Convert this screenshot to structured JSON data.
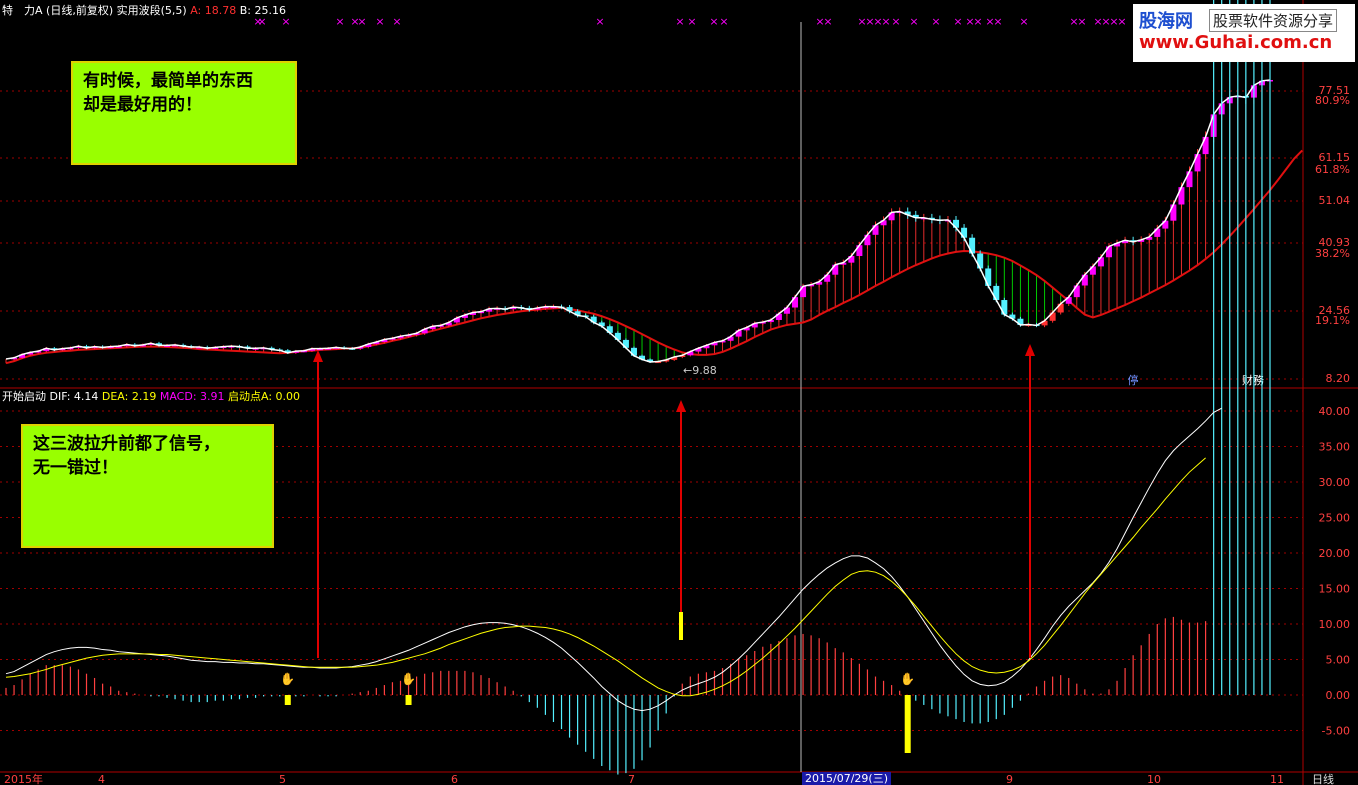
{
  "colors": {
    "up": "#ff3030",
    "down": "#54f0ff",
    "magenta": "#ff00ff",
    "white": "#ffffff",
    "yellow": "#ffff00",
    "grid": "#a00000",
    "axis": "#b00000",
    "green": "#00e000"
  },
  "header": {
    "stock": "特　力A",
    "mode": "(日线,前复权)",
    "indicator": "实用波段(5,5)",
    "a_label": "A: 18.78",
    "b_label": "B: 25.16"
  },
  "subheader": {
    "name": "开始启动",
    "dif": "DIF: 4.14",
    "dea": "DEA: 2.19",
    "macd": "MACD: 3.91",
    "start": "启动点A: 0.00"
  },
  "brand": {
    "name": "股海网",
    "slogan": "股票软件资源分享",
    "url": "www.Guhai.com.cn"
  },
  "notes": {
    "top": "有时候，最简单的东西\n却是最好用的！",
    "bottom": "这三波拉升前都了信号，\n无一错过！"
  },
  "chart_data": [
    {
      "type": "line",
      "title": "实用波段(5,5)",
      "y_ticks": [
        "77.51",
        "61.15",
        "51.04",
        "40.93",
        "24.56",
        "8.20"
      ],
      "pct_ticks": [
        "80.9%",
        "61.8%",
        "38.2%",
        "19.1%"
      ],
      "annotations": {
        "low_label": "←9.88",
        "stop_tag": "停",
        "fin_tag": "财務"
      },
      "series": [
        {
          "name": "price",
          "values": [
            13.0,
            13.3,
            14.1,
            14.6,
            14.9,
            15.6,
            15.2,
            15.5,
            15.7,
            16.1,
            15.7,
            16.0,
            15.8,
            16.0,
            16.1,
            16.5,
            16.2,
            16.4,
            16.8,
            16.3,
            16.3,
            16.4,
            16.1,
            15.9,
            15.9,
            15.6,
            15.8,
            16.0,
            16.1,
            16.0,
            15.6,
            15.6,
            15.7,
            15.3,
            15.1,
            14.5,
            14.9,
            15.0,
            15.5,
            15.5,
            15.6,
            15.8,
            15.6,
            15.5,
            15.9,
            16.6,
            17.1,
            17.7,
            18.0,
            18.5,
            18.8,
            19.2,
            20.2,
            20.9,
            21.1,
            21.8,
            22.9,
            23.6,
            24.2,
            24.4,
            25.1,
            25.2,
            25.0,
            25.5,
            25.3,
            24.9,
            25.3,
            25.6,
            25.6,
            25.5,
            24.5,
            23.5,
            23.2,
            21.8,
            20.9,
            19.3,
            17.6,
            15.7,
            13.8,
            12.9,
            12.3,
            12.4,
            12.8,
            13.5,
            13.9,
            14.8,
            15.6,
            16.3,
            17.0,
            17.4,
            18.4,
            19.9,
            20.6,
            21.6,
            21.9,
            22.4,
            23.9,
            25.4,
            27.9,
            30.5,
            30.9,
            31.6,
            33.3,
            35.7,
            36.2,
            37.8,
            40.4,
            42.9,
            45.2,
            46.4,
            48.3,
            48.5,
            47.7,
            47.0,
            47.0,
            46.6,
            46.4,
            46.5,
            44.6,
            42.2,
            38.4,
            34.8,
            30.6,
            27.2,
            23.7,
            22.7,
            21.2,
            21.3,
            21.1,
            22.2,
            24.2,
            26.3,
            27.9,
            30.7,
            33.3,
            35.3,
            37.5,
            40.1,
            40.9,
            41.6,
            41.2,
            41.7,
            42.4,
            44.4,
            46.3,
            50.2,
            54.3,
            58.0,
            62.1,
            66.3,
            71.8,
            74.5,
            76.0,
            76.3,
            75.9,
            78.9,
            80.0,
            80.2
          ]
        },
        {
          "name": "support",
          "values": [
            12.0,
            12.5,
            13.2,
            13.8,
            14.2,
            14.5,
            14.7,
            14.9,
            15.0,
            15.2,
            15.3,
            15.4,
            15.5,
            15.6,
            15.7,
            15.8,
            15.9,
            16.0,
            16.0,
            16.0,
            15.9,
            15.8,
            15.7,
            15.6,
            15.4,
            15.3,
            15.2,
            15.1,
            15.0,
            14.9,
            14.8,
            14.7,
            14.6,
            14.5,
            14.4,
            14.5,
            14.7,
            14.9,
            15.0,
            15.2,
            15.3,
            15.4,
            15.5,
            15.6,
            15.7,
            16.1,
            16.5,
            16.9,
            17.4,
            17.8,
            18.3,
            18.8,
            19.3,
            19.8,
            20.3,
            20.8,
            21.3,
            21.8,
            22.3,
            22.8,
            23.2,
            23.6,
            23.9,
            24.2,
            24.5,
            24.7,
            24.9,
            25.1,
            25.2,
            25.3,
            25.0,
            24.7,
            24.3,
            23.9,
            23.3,
            22.6,
            21.8,
            20.9,
            20.0,
            19.0,
            18.0,
            17.0,
            16.1,
            15.3,
            14.6,
            14.2,
            14.0,
            14.0,
            14.2,
            14.7,
            15.5,
            16.4,
            17.3,
            18.3,
            19.2,
            20.1,
            20.7,
            21.2,
            21.5,
            21.8,
            22.5,
            23.6,
            24.6,
            25.5,
            26.5,
            27.4,
            28.4,
            29.5,
            30.6,
            31.6,
            32.7,
            33.7,
            34.7,
            35.6,
            36.4,
            37.2,
            37.9,
            38.4,
            38.8,
            39.0,
            38.9,
            38.7,
            38.4,
            38.0,
            37.4,
            36.6,
            35.5,
            34.4,
            33.2,
            31.8,
            30.2,
            28.6,
            27.0,
            25.3,
            23.7,
            23.0,
            23.6,
            24.4,
            25.2,
            26.0,
            26.9,
            27.8,
            28.8,
            29.8,
            30.8,
            31.9,
            33.1,
            34.3,
            35.6,
            37.1,
            38.7,
            40.6,
            42.6,
            44.7,
            46.9,
            49.1,
            51.4,
            53.6,
            56.0,
            58.5,
            61.0,
            63.0
          ]
        }
      ]
    },
    {
      "type": "line",
      "title": "开始启动",
      "y_ticks": [
        "40.00",
        "35.00",
        "30.00",
        "25.00",
        "20.00",
        "15.00",
        "10.00",
        "5.00",
        "0.00",
        "-5.00"
      ],
      "x_labels": [
        "2015年",
        "4",
        "5",
        "6",
        "7",
        "2015/07/29(三)",
        "9",
        "10",
        "11",
        "日线"
      ],
      "signal_days": [
        35,
        50,
        112,
        172
      ],
      "series": [
        {
          "name": "DIF",
          "values": [
            3.0,
            3.3,
            3.9,
            4.5,
            5.1,
            5.7,
            6.1,
            6.4,
            6.6,
            6.7,
            6.7,
            6.6,
            6.4,
            6.3,
            6.1,
            6.0,
            5.9,
            5.8,
            5.7,
            5.6,
            5.5,
            5.3,
            5.1,
            4.9,
            4.8,
            4.7,
            4.7,
            4.6,
            4.6,
            4.5,
            4.5,
            4.4,
            4.4,
            4.3,
            4.2,
            4.1,
            4.0,
            3.9,
            3.9,
            3.8,
            3.8,
            3.8,
            3.9,
            4.0,
            4.2,
            4.4,
            4.7,
            5.1,
            5.5,
            5.9,
            6.3,
            6.8,
            7.3,
            7.8,
            8.3,
            8.8,
            9.2,
            9.6,
            9.9,
            10.1,
            10.2,
            10.2,
            10.1,
            9.9,
            9.6,
            9.2,
            8.7,
            8.1,
            7.4,
            6.6,
            5.6,
            4.6,
            3.5,
            2.4,
            1.2,
            0.2,
            -0.8,
            -1.5,
            -2.0,
            -2.2,
            -2.0,
            -1.5,
            -0.8,
            0.0,
            0.7,
            1.2,
            1.6,
            2.0,
            2.5,
            3.2,
            4.1,
            5.1,
            6.2,
            7.4,
            8.6,
            9.8,
            11.0,
            12.3,
            13.6,
            14.9,
            16.0,
            17.0,
            17.9,
            18.6,
            19.2,
            19.6,
            19.6,
            19.3,
            18.6,
            17.8,
            16.7,
            15.3,
            13.8,
            12.1,
            10.4,
            8.7,
            7.0,
            5.5,
            4.1,
            2.9,
            2.0,
            1.5,
            1.3,
            1.4,
            1.8,
            2.6,
            3.6,
            4.9,
            6.4,
            8.0,
            9.7,
            11.2,
            12.5,
            13.6,
            14.7,
            15.8,
            17.1,
            18.7,
            20.6,
            22.8,
            25.0,
            27.1,
            29.2,
            31.2,
            33.0,
            34.4,
            35.5,
            36.5,
            37.5,
            38.6,
            39.8,
            40.4
          ]
        },
        {
          "name": "DEA",
          "values": [
            2.5,
            2.6,
            2.8,
            3.0,
            3.3,
            3.6,
            4.0,
            4.3,
            4.6,
            4.9,
            5.2,
            5.4,
            5.6,
            5.7,
            5.8,
            5.8,
            5.8,
            5.8,
            5.8,
            5.7,
            5.7,
            5.6,
            5.5,
            5.4,
            5.3,
            5.2,
            5.1,
            5.0,
            4.9,
            4.8,
            4.7,
            4.6,
            4.5,
            4.4,
            4.3,
            4.2,
            4.1,
            4.0,
            3.9,
            3.9,
            3.9,
            3.9,
            3.9,
            3.9,
            4.0,
            4.1,
            4.2,
            4.4,
            4.6,
            4.9,
            5.2,
            5.5,
            5.8,
            6.2,
            6.6,
            7.1,
            7.5,
            7.9,
            8.3,
            8.7,
            9.0,
            9.3,
            9.5,
            9.6,
            9.7,
            9.7,
            9.6,
            9.5,
            9.3,
            9.0,
            8.6,
            8.1,
            7.5,
            6.9,
            6.2,
            5.5,
            4.8,
            4.0,
            3.2,
            2.4,
            1.7,
            1.0,
            0.5,
            0.1,
            -0.1,
            -0.1,
            0.1,
            0.4,
            0.8,
            1.3,
            1.9,
            2.6,
            3.4,
            4.3,
            5.2,
            6.2,
            7.2,
            8.3,
            9.4,
            10.6,
            11.8,
            13.0,
            14.2,
            15.3,
            16.2,
            17.0,
            17.4,
            17.5,
            17.3,
            16.8,
            16.0,
            15.0,
            13.8,
            12.5,
            11.1,
            9.7,
            8.3,
            7.0,
            5.8,
            4.8,
            4.0,
            3.5,
            3.2,
            3.1,
            3.2,
            3.5,
            4.0,
            4.8,
            5.8,
            7.0,
            8.4,
            9.8,
            11.3,
            12.8,
            14.3,
            15.7,
            17.0,
            18.3,
            19.6,
            20.9,
            22.2,
            23.6,
            24.9,
            26.2,
            27.6,
            28.9,
            30.2,
            31.4,
            32.4,
            33.4
          ]
        }
      ]
    }
  ]
}
